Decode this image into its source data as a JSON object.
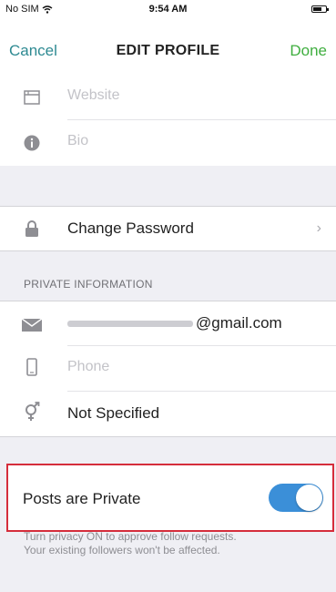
{
  "status_bar": {
    "carrier": "No SIM",
    "time": "9:54 AM"
  },
  "nav": {
    "cancel": "Cancel",
    "title": "EDIT PROFILE",
    "done": "Done"
  },
  "profile": {
    "website_placeholder": "Website",
    "bio_placeholder": "Bio"
  },
  "password": {
    "label": "Change Password"
  },
  "private_info": {
    "header": "PRIVATE INFORMATION",
    "email_visible_part": "@gmail.com",
    "phone_placeholder": "Phone",
    "gender": "Not Specified"
  },
  "privacy": {
    "label": "Posts are Private",
    "enabled": true,
    "note_line1": "Turn privacy ON to approve follow requests.",
    "note_line2": "Your existing followers won't be affected."
  },
  "icons": [
    "wifi-icon",
    "battery-icon",
    "website-icon",
    "info-icon",
    "lock-icon",
    "chevron-right-icon",
    "mail-icon",
    "phone-icon",
    "gender-icon"
  ],
  "colors": {
    "cancel": "#2e8a92",
    "done": "#3fae3f",
    "toggle_on": "#3b8fd8",
    "highlight_border": "#d52d3b"
  }
}
